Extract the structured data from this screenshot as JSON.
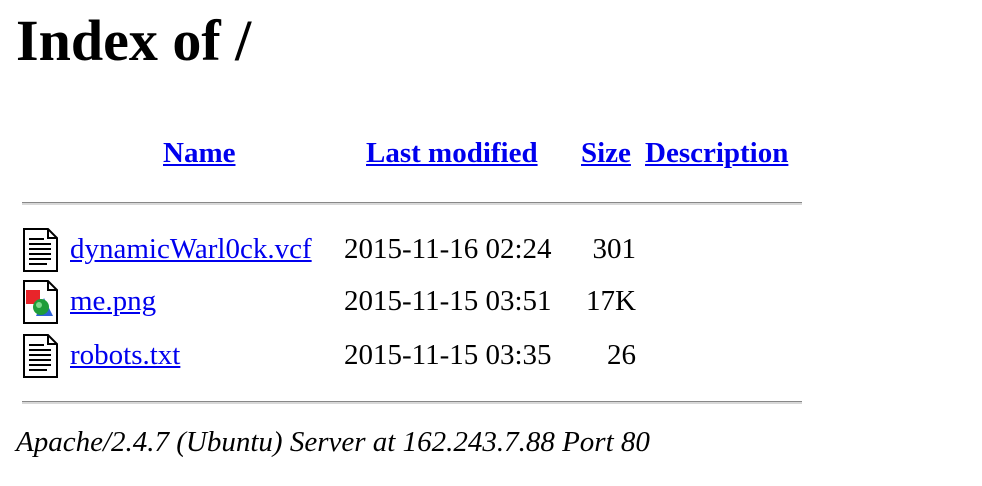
{
  "page": {
    "title": "Index of /"
  },
  "table": {
    "headers": {
      "name": "Name",
      "last_modified": "Last modified",
      "size": "Size",
      "description": "Description"
    },
    "rows": [
      {
        "icon": "text-file-icon",
        "name": "dynamicWarl0ck.vcf",
        "last_modified": "2015-11-16 02:24",
        "size": "301",
        "description": ""
      },
      {
        "icon": "image-file-icon",
        "name": "me.png",
        "last_modified": "2015-11-15 03:51",
        "size": "17K",
        "description": ""
      },
      {
        "icon": "text-file-icon",
        "name": "robots.txt",
        "last_modified": "2015-11-15 03:35",
        "size": "26",
        "description": ""
      }
    ]
  },
  "footer": {
    "address": "Apache/2.4.7 (Ubuntu) Server at 162.243.7.88 Port 80"
  },
  "colors": {
    "link": "#0000ee",
    "text": "#000000",
    "background": "#ffffff"
  }
}
